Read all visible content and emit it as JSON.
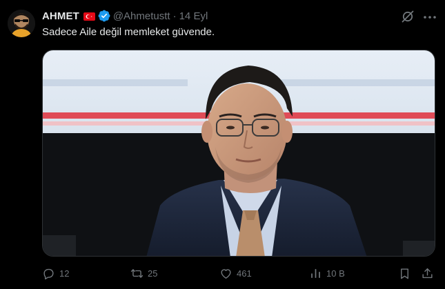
{
  "author": {
    "display_name": "AHMET",
    "flag_icon": "turkey-flag-icon",
    "verified_icon": "verified-badge-icon",
    "handle": "@Ahmetustt",
    "separator": "·",
    "date": "14 Eyl"
  },
  "tweet": {
    "text": "Sadece Aile değil memleket güvende."
  },
  "header_actions": {
    "grok_icon": "grok-icon",
    "more_icon": "more-icon"
  },
  "actions": {
    "reply": {
      "icon": "reply-icon",
      "count": "12"
    },
    "retweet": {
      "icon": "retweet-icon",
      "count": "25"
    },
    "like": {
      "icon": "like-icon",
      "count": "461"
    },
    "views": {
      "icon": "views-icon",
      "count": "10 B"
    },
    "bookmark": {
      "icon": "bookmark-icon"
    },
    "share": {
      "icon": "share-icon"
    }
  },
  "colors": {
    "background": "#000000",
    "text_primary": "#e7e9ea",
    "text_secondary": "#71767b",
    "verified_blue": "#1d9bf0",
    "flag_red": "#e30a17"
  }
}
